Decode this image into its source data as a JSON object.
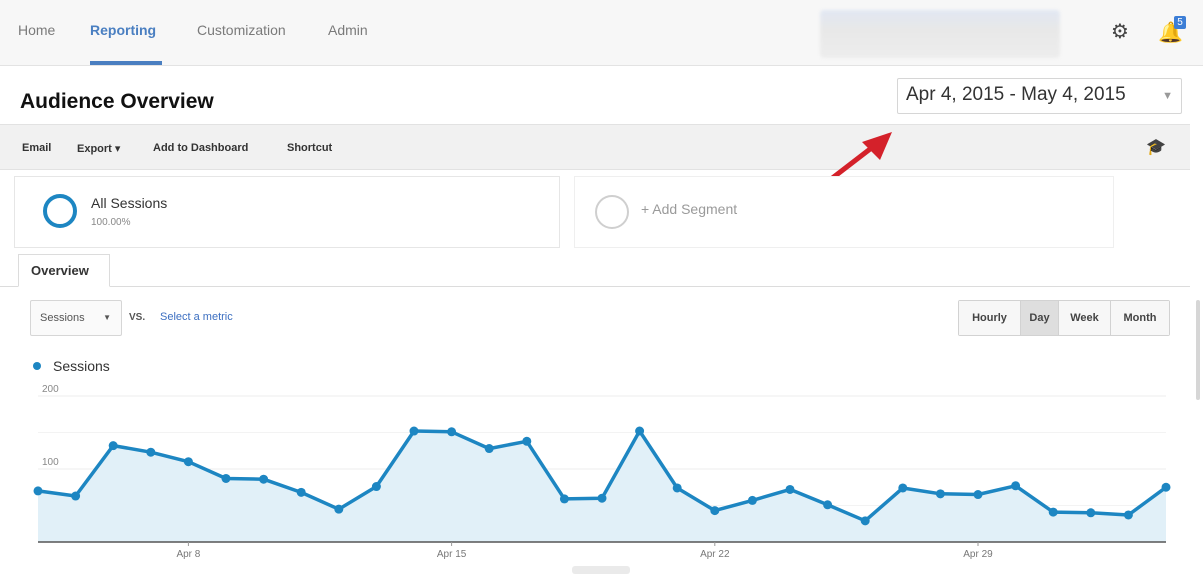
{
  "nav": {
    "items": [
      {
        "label": "Home"
      },
      {
        "label": "Reporting"
      },
      {
        "label": "Customization"
      },
      {
        "label": "Admin"
      }
    ],
    "active": "Reporting",
    "notification_count": "5",
    "icons": {
      "settings": "gear-icon",
      "notifications": "bell-icon"
    }
  },
  "page": {
    "title": "Audience Overview",
    "date_range": "Apr 4, 2015 - May 4, 2015"
  },
  "toolbar": {
    "email": "Email",
    "export": "Export ▾",
    "add_to_dashboard": "Add to Dashboard",
    "shortcut": "Shortcut",
    "icon": "graduation-cap-icon"
  },
  "segments": {
    "all_sessions": {
      "name": "All Sessions",
      "percent": "100.00%"
    },
    "add_segment": "+ Add Segment"
  },
  "tabs": {
    "overview": "Overview"
  },
  "controls": {
    "metric": "Sessions",
    "vs": "VS.",
    "select_metric": "Select a metric",
    "granularity": [
      "Hourly",
      "Day",
      "Week",
      "Month"
    ],
    "selected_granularity": "Day"
  },
  "colors": {
    "accent": "#1d86c2",
    "link": "#3c6fc1",
    "fill": "#e1f0f8",
    "annotation_arrow": "#d4212a"
  },
  "chart_data": {
    "type": "area",
    "series": [
      {
        "name": "Sessions",
        "values": [
          70,
          63,
          132,
          123,
          110,
          87,
          86,
          68,
          45,
          76,
          152,
          151,
          128,
          138,
          59,
          60,
          152,
          74,
          43,
          57,
          72,
          51,
          29,
          74,
          66,
          65,
          77,
          41,
          40,
          37,
          75
        ]
      }
    ],
    "x_start": "Apr 4, 2015",
    "x_end": "May 4, 2015",
    "x_tick_labels": [
      "Apr 8",
      "Apr 15",
      "Apr 22",
      "Apr 29"
    ],
    "y_tick_labels": [
      "200",
      "100"
    ],
    "ylim": [
      0,
      200
    ],
    "grid": true,
    "legend": "top-left",
    "xlabel": "",
    "ylabel": ""
  }
}
